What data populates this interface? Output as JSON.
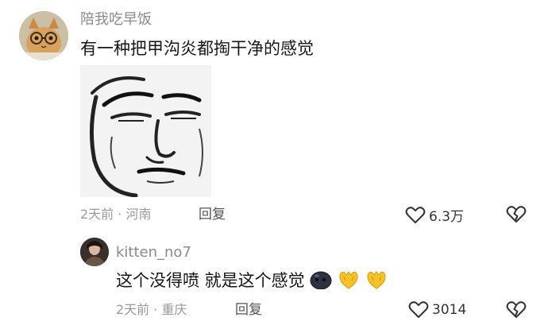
{
  "comment": {
    "username": "陪我吃早饭",
    "text": "有一种把甲沟炎都掏干净的感觉",
    "time": "2天前",
    "location": "河南",
    "reply_label": "回复",
    "likes": "6.3万",
    "avatar_icon": "cat-with-glasses-avatar",
    "image_icon": "stick-figure-face-meme"
  },
  "reply": {
    "username": "kitten_no7",
    "text": "这个没得喷 就是这个感觉",
    "time": "2天前",
    "location": "重庆",
    "reply_label": "回复",
    "likes": "3014",
    "avatar_icon": "person-photo-avatar",
    "emojis": [
      "dark-round-face-emoji",
      "yellow-heart-hands-emoji",
      "yellow-heart-hands-emoji"
    ]
  },
  "colors": {
    "text": "#161616",
    "meta": "#9a9a9a",
    "emoji_yellow": "#f5c325"
  }
}
